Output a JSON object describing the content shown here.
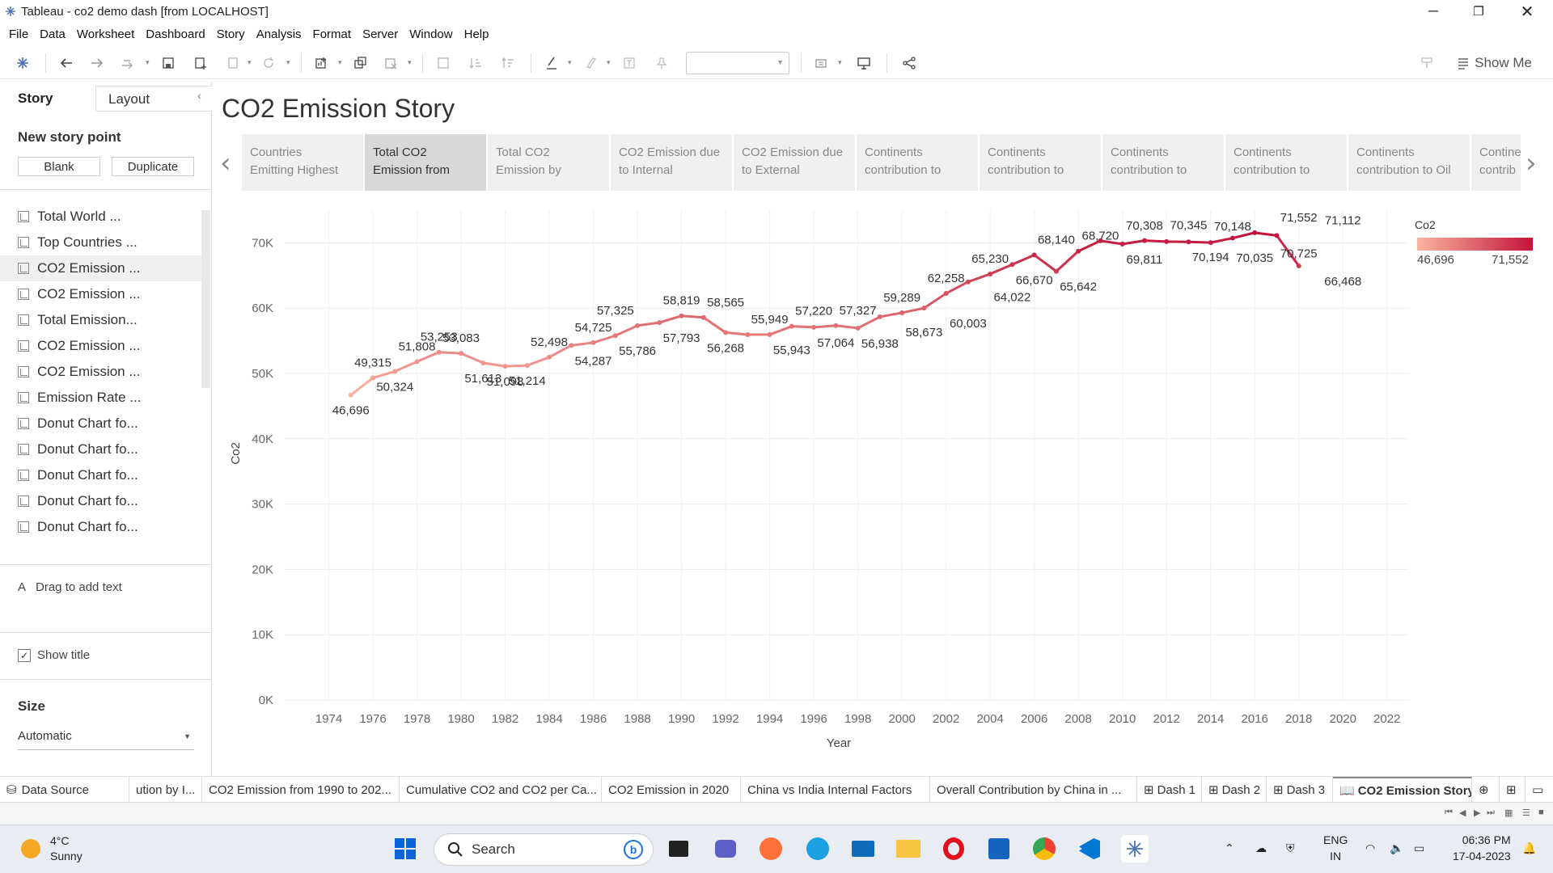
{
  "window": {
    "title": "Tableau - co2 demo dash [from LOCALHOST]"
  },
  "menu": [
    "File",
    "Data",
    "Worksheet",
    "Dashboard",
    "Story",
    "Analysis",
    "Format",
    "Server",
    "Window",
    "Help"
  ],
  "toolbar": {
    "show_me_label": "Show Me",
    "combo_value": ""
  },
  "left_pane": {
    "tab_story": "Story",
    "tab_layout": "Layout",
    "new_story_point": "New story point",
    "blank_label": "Blank",
    "duplicate_label": "Duplicate",
    "sheets": [
      "Total World ...",
      "Top Countries ...",
      "CO2 Emission ...",
      "CO2 Emission ...",
      "Total Emission...",
      "CO2 Emission ...",
      "CO2 Emission ...",
      "Emission Rate ...",
      "Donut Chart fo...",
      "Donut Chart fo...",
      "Donut Chart fo...",
      "Donut Chart fo...",
      "Donut Chart fo..."
    ],
    "drag_text": "Drag to add text",
    "show_title": "Show title",
    "size_title": "Size",
    "size_value": "Automatic"
  },
  "story": {
    "title": "CO2 Emission Story",
    "points": [
      {
        "line1": "Countries",
        "line2": "Emitting Highest"
      },
      {
        "line1": "Total CO2",
        "line2": "Emission from"
      },
      {
        "line1": "Total CO2",
        "line2": "Emission by"
      },
      {
        "line1": "CO2 Emission due",
        "line2": "to Internal"
      },
      {
        "line1": "CO2 Emission due",
        "line2": "to External"
      },
      {
        "line1": "Continents",
        "line2": "contribution to"
      },
      {
        "line1": "Continents",
        "line2": "contribution to"
      },
      {
        "line1": "Continents",
        "line2": "contribution to"
      },
      {
        "line1": "Continents",
        "line2": "contribution to"
      },
      {
        "line1": "Continents",
        "line2": "contribution to Oil"
      },
      {
        "line1": "Contine",
        "line2": "contrib"
      }
    ]
  },
  "chart_data": {
    "type": "line",
    "title": "",
    "xlabel": "Year",
    "ylabel": "Co2",
    "xlim": [
      1972,
      2023
    ],
    "ylim": [
      0,
      75000
    ],
    "x_ticks": [
      1974,
      1976,
      1978,
      1980,
      1982,
      1984,
      1986,
      1988,
      1990,
      1992,
      1994,
      1996,
      1998,
      2000,
      2002,
      2004,
      2006,
      2008,
      2010,
      2012,
      2014,
      2016,
      2018,
      2020,
      2022
    ],
    "y_ticks": [
      0,
      10000,
      20000,
      30000,
      40000,
      50000,
      60000,
      70000
    ],
    "y_tick_labels": [
      "0K",
      "10K",
      "20K",
      "30K",
      "40K",
      "50K",
      "60K",
      "70K"
    ],
    "x": [
      1975,
      1976,
      1977,
      1978,
      1979,
      1980,
      1981,
      1982,
      1983,
      1984,
      1985,
      1986,
      1987,
      1988,
      1989,
      1990,
      1991,
      1992,
      1993,
      1994,
      1995,
      1996,
      1997,
      1998,
      1999,
      2000,
      2001,
      2002,
      2003,
      2004,
      2005,
      2006,
      2007,
      2008,
      2009,
      2010,
      2011,
      2012,
      2013,
      2014,
      2015,
      2016,
      2017,
      2018,
      2019,
      2020
    ],
    "values": [
      46696,
      49315,
      50324,
      51808,
      53253,
      53083,
      51613,
      51098,
      51214,
      52498,
      54287,
      54725,
      55786,
      57325,
      57793,
      58819,
      58565,
      56268,
      55943,
      55949,
      57220,
      57064,
      57327,
      56938,
      58673,
      59289,
      60003,
      62258,
      64022,
      65230,
      66670,
      68140,
      65642,
      68720,
      70308,
      69811,
      70345,
      70194,
      70148,
      70035,
      70725,
      71552,
      71112,
      66468
    ],
    "labels": [
      {
        "year": 1975,
        "text": "46,696",
        "pos": "below"
      },
      {
        "year": 1976,
        "text": "49,315",
        "pos": "above"
      },
      {
        "year": 1977,
        "text": "50,324",
        "pos": "below"
      },
      {
        "year": 1978,
        "text": "51,808",
        "pos": "above"
      },
      {
        "year": 1979,
        "text": "53,253",
        "pos": "above"
      },
      {
        "year": 1980,
        "text": "53,083",
        "pos": "above"
      },
      {
        "year": 1981,
        "text": "51,613",
        "pos": "below"
      },
      {
        "year": 1982,
        "text": "51,098",
        "pos": "below"
      },
      {
        "year": 1983,
        "text": "51,214",
        "pos": "below"
      },
      {
        "year": 1984,
        "text": "52,498",
        "pos": "above"
      },
      {
        "year": 1986,
        "text": "54,725",
        "pos": "above"
      },
      {
        "year": 1986,
        "text": "54,287",
        "pos": "below"
      },
      {
        "year": 1987,
        "text": "57,325",
        "pos": "above"
      },
      {
        "year": 1988,
        "text": "55,786",
        "pos": "below"
      },
      {
        "year": 1990,
        "text": "58,819",
        "pos": "above"
      },
      {
        "year": 1990,
        "text": "57,793",
        "pos": "below"
      },
      {
        "year": 1992,
        "text": "58,565",
        "pos": "above"
      },
      {
        "year": 1992,
        "text": "56,268",
        "pos": "below"
      },
      {
        "year": 1994,
        "text": "55,949",
        "pos": "above"
      },
      {
        "year": 1995,
        "text": "55,943",
        "pos": "below"
      },
      {
        "year": 1996,
        "text": "57,220",
        "pos": "above"
      },
      {
        "year": 1997,
        "text": "57,064",
        "pos": "below"
      },
      {
        "year": 1998,
        "text": "57,327",
        "pos": "above"
      },
      {
        "year": 1999,
        "text": "56,938",
        "pos": "below"
      },
      {
        "year": 2000,
        "text": "59,289",
        "pos": "above"
      },
      {
        "year": 2001,
        "text": "58,673",
        "pos": "below"
      },
      {
        "year": 2002,
        "text": "62,258",
        "pos": "above"
      },
      {
        "year": 2003,
        "text": "60,003",
        "pos": "below"
      },
      {
        "year": 2004,
        "text": "65,230",
        "pos": "above"
      },
      {
        "year": 2005,
        "text": "64,022",
        "pos": "below"
      },
      {
        "year": 2006,
        "text": "66,670",
        "pos": "below"
      },
      {
        "year": 2007,
        "text": "68,140",
        "pos": "above"
      },
      {
        "year": 2008,
        "text": "65,642",
        "pos": "below"
      },
      {
        "year": 2009,
        "text": "68,720",
        "pos": "above"
      },
      {
        "year": 2011,
        "text": "70,308",
        "pos": "above"
      },
      {
        "year": 2011,
        "text": "69,811",
        "pos": "below"
      },
      {
        "year": 2013,
        "text": "70,345",
        "pos": "above"
      },
      {
        "year": 2014,
        "text": "70,194",
        "pos": "below"
      },
      {
        "year": 2015,
        "text": "70,148",
        "pos": "above"
      },
      {
        "year": 2016,
        "text": "70,035",
        "pos": "below"
      },
      {
        "year": 2018,
        "text": "71,552",
        "pos": "above"
      },
      {
        "year": 2018,
        "text": "70,725",
        "pos": "below"
      },
      {
        "year": 2020,
        "text": "71,112",
        "pos": "above"
      },
      {
        "year": 2020,
        "text": "66,468",
        "pos": "below"
      }
    ],
    "color_legend": {
      "title": "Co2",
      "min_label": "46,696",
      "max_label": "71,552",
      "min_color": "#fbb4a0",
      "max_color": "#c2143a"
    },
    "grid": true
  },
  "sheet_tabs": [
    "Data Source",
    "ution by I...",
    "CO2 Emission from 1990 to 202...",
    "Cumulative CO2 and CO2 per Ca...",
    "CO2 Emission in 2020",
    "China vs India Internal Factors",
    "Overall Contribution by China in ...",
    "Dash 1",
    "Dash 2",
    "Dash 3",
    "CO2 Emission Story"
  ],
  "taskbar": {
    "temperature": "4°C",
    "weather": "Sunny",
    "search_label": "Search",
    "lang1": "ENG",
    "lang2": "IN",
    "time": "06:36 PM",
    "date": "17-04-2023"
  }
}
